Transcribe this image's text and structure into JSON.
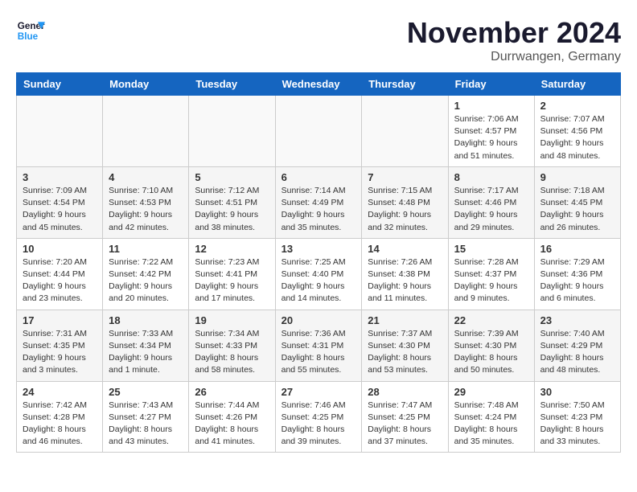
{
  "header": {
    "logo_line1": "General",
    "logo_line2": "Blue",
    "month_title": "November 2024",
    "location": "Durrwangen, Germany"
  },
  "weekdays": [
    "Sunday",
    "Monday",
    "Tuesday",
    "Wednesday",
    "Thursday",
    "Friday",
    "Saturday"
  ],
  "weeks": [
    {
      "days": [
        {
          "date": "",
          "info": ""
        },
        {
          "date": "",
          "info": ""
        },
        {
          "date": "",
          "info": ""
        },
        {
          "date": "",
          "info": ""
        },
        {
          "date": "",
          "info": ""
        },
        {
          "date": "1",
          "info": "Sunrise: 7:06 AM\nSunset: 4:57 PM\nDaylight: 9 hours\nand 51 minutes."
        },
        {
          "date": "2",
          "info": "Sunrise: 7:07 AM\nSunset: 4:56 PM\nDaylight: 9 hours\nand 48 minutes."
        }
      ]
    },
    {
      "days": [
        {
          "date": "3",
          "info": "Sunrise: 7:09 AM\nSunset: 4:54 PM\nDaylight: 9 hours\nand 45 minutes."
        },
        {
          "date": "4",
          "info": "Sunrise: 7:10 AM\nSunset: 4:53 PM\nDaylight: 9 hours\nand 42 minutes."
        },
        {
          "date": "5",
          "info": "Sunrise: 7:12 AM\nSunset: 4:51 PM\nDaylight: 9 hours\nand 38 minutes."
        },
        {
          "date": "6",
          "info": "Sunrise: 7:14 AM\nSunset: 4:49 PM\nDaylight: 9 hours\nand 35 minutes."
        },
        {
          "date": "7",
          "info": "Sunrise: 7:15 AM\nSunset: 4:48 PM\nDaylight: 9 hours\nand 32 minutes."
        },
        {
          "date": "8",
          "info": "Sunrise: 7:17 AM\nSunset: 4:46 PM\nDaylight: 9 hours\nand 29 minutes."
        },
        {
          "date": "9",
          "info": "Sunrise: 7:18 AM\nSunset: 4:45 PM\nDaylight: 9 hours\nand 26 minutes."
        }
      ]
    },
    {
      "days": [
        {
          "date": "10",
          "info": "Sunrise: 7:20 AM\nSunset: 4:44 PM\nDaylight: 9 hours\nand 23 minutes."
        },
        {
          "date": "11",
          "info": "Sunrise: 7:22 AM\nSunset: 4:42 PM\nDaylight: 9 hours\nand 20 minutes."
        },
        {
          "date": "12",
          "info": "Sunrise: 7:23 AM\nSunset: 4:41 PM\nDaylight: 9 hours\nand 17 minutes."
        },
        {
          "date": "13",
          "info": "Sunrise: 7:25 AM\nSunset: 4:40 PM\nDaylight: 9 hours\nand 14 minutes."
        },
        {
          "date": "14",
          "info": "Sunrise: 7:26 AM\nSunset: 4:38 PM\nDaylight: 9 hours\nand 11 minutes."
        },
        {
          "date": "15",
          "info": "Sunrise: 7:28 AM\nSunset: 4:37 PM\nDaylight: 9 hours\nand 9 minutes."
        },
        {
          "date": "16",
          "info": "Sunrise: 7:29 AM\nSunset: 4:36 PM\nDaylight: 9 hours\nand 6 minutes."
        }
      ]
    },
    {
      "days": [
        {
          "date": "17",
          "info": "Sunrise: 7:31 AM\nSunset: 4:35 PM\nDaylight: 9 hours\nand 3 minutes."
        },
        {
          "date": "18",
          "info": "Sunrise: 7:33 AM\nSunset: 4:34 PM\nDaylight: 9 hours\nand 1 minute."
        },
        {
          "date": "19",
          "info": "Sunrise: 7:34 AM\nSunset: 4:33 PM\nDaylight: 8 hours\nand 58 minutes."
        },
        {
          "date": "20",
          "info": "Sunrise: 7:36 AM\nSunset: 4:31 PM\nDaylight: 8 hours\nand 55 minutes."
        },
        {
          "date": "21",
          "info": "Sunrise: 7:37 AM\nSunset: 4:30 PM\nDaylight: 8 hours\nand 53 minutes."
        },
        {
          "date": "22",
          "info": "Sunrise: 7:39 AM\nSunset: 4:30 PM\nDaylight: 8 hours\nand 50 minutes."
        },
        {
          "date": "23",
          "info": "Sunrise: 7:40 AM\nSunset: 4:29 PM\nDaylight: 8 hours\nand 48 minutes."
        }
      ]
    },
    {
      "days": [
        {
          "date": "24",
          "info": "Sunrise: 7:42 AM\nSunset: 4:28 PM\nDaylight: 8 hours\nand 46 minutes."
        },
        {
          "date": "25",
          "info": "Sunrise: 7:43 AM\nSunset: 4:27 PM\nDaylight: 8 hours\nand 43 minutes."
        },
        {
          "date": "26",
          "info": "Sunrise: 7:44 AM\nSunset: 4:26 PM\nDaylight: 8 hours\nand 41 minutes."
        },
        {
          "date": "27",
          "info": "Sunrise: 7:46 AM\nSunset: 4:25 PM\nDaylight: 8 hours\nand 39 minutes."
        },
        {
          "date": "28",
          "info": "Sunrise: 7:47 AM\nSunset: 4:25 PM\nDaylight: 8 hours\nand 37 minutes."
        },
        {
          "date": "29",
          "info": "Sunrise: 7:48 AM\nSunset: 4:24 PM\nDaylight: 8 hours\nand 35 minutes."
        },
        {
          "date": "30",
          "info": "Sunrise: 7:50 AM\nSunset: 4:23 PM\nDaylight: 8 hours\nand 33 minutes."
        }
      ]
    }
  ]
}
